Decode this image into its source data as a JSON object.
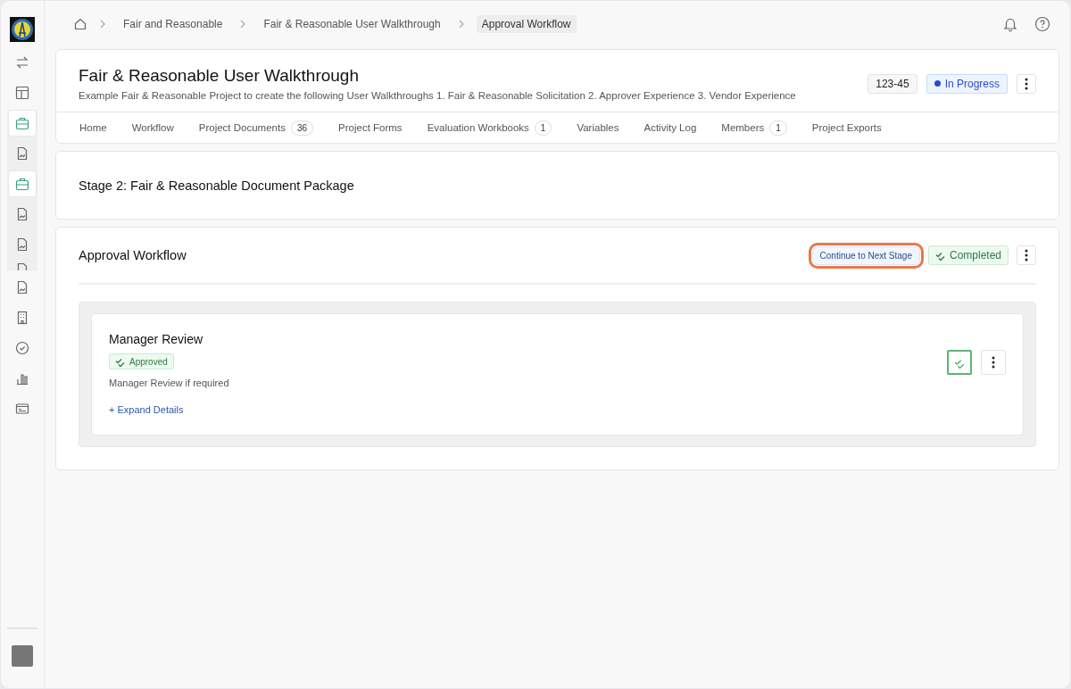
{
  "sidebar": {
    "items": [
      {
        "kind": "swap",
        "selected": false
      },
      {
        "kind": "layout",
        "selected": false
      },
      {
        "kind": "briefcase",
        "selected": true,
        "expanded": true,
        "children": [
          {
            "kind": "document",
            "selected": false
          },
          {
            "kind": "briefcase",
            "selected": true
          },
          {
            "kind": "document",
            "selected": false
          },
          {
            "kind": "document",
            "selected": false
          },
          {
            "kind": "document-cut",
            "selected": false
          }
        ]
      },
      {
        "kind": "document",
        "selected": false
      },
      {
        "kind": "building",
        "selected": false
      },
      {
        "kind": "check-circle",
        "selected": false
      },
      {
        "kind": "chart",
        "selected": false
      },
      {
        "kind": "card",
        "selected": false
      }
    ]
  },
  "breadcrumbs": [
    {
      "label": "Fair and Reasonable",
      "selected": false
    },
    {
      "label": "Fair & Reasonable User Walkthrough",
      "selected": false
    },
    {
      "label": "Approval Workflow",
      "selected": true
    }
  ],
  "project": {
    "title": "Fair & Reasonable User Walkthrough",
    "description": "Example Fair & Reasonable Project to create the following User Walkthroughs 1. Fair & Reasonable Solicitation 2. Approver Experience 3. Vendor Experience",
    "code": "123-45",
    "status": "In Progress"
  },
  "tabs": [
    {
      "label": "Home",
      "selected": false
    },
    {
      "label": "Workflow",
      "selected": false
    },
    {
      "label": "Project Documents",
      "count": "36",
      "selected": false
    },
    {
      "label": "Project Forms",
      "selected": false
    },
    {
      "label": "Evaluation Workbooks",
      "count": "1",
      "selected": false
    },
    {
      "label": "Variables",
      "selected": false
    },
    {
      "label": "Activity Log",
      "selected": false
    },
    {
      "label": "Members",
      "count": "1",
      "selected": false
    },
    {
      "label": "Project Exports",
      "selected": false
    }
  ],
  "stage": {
    "title": "Stage 2: Fair & Reasonable Document Package"
  },
  "workflow": {
    "title": "Approval Workflow",
    "action": {
      "label": "Continue to Next Stage",
      "highlighted": true
    },
    "status": "Completed",
    "steps": [
      {
        "title": "Manager Review",
        "status": "Approved",
        "description": "Manager Review if required",
        "link": "+ Expand Details",
        "checked": true
      }
    ]
  }
}
